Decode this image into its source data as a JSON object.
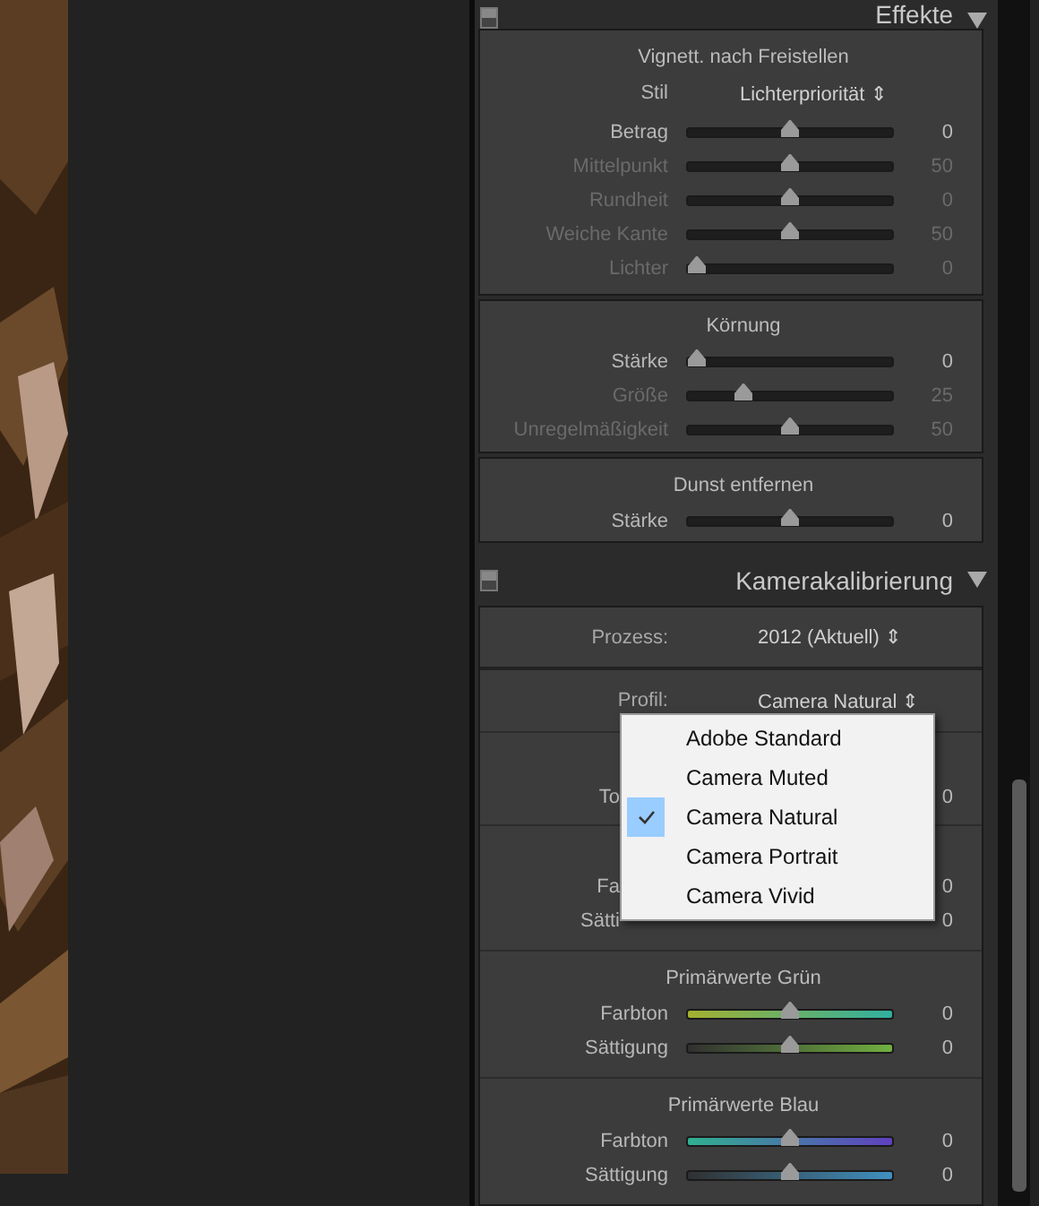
{
  "effects_header": {
    "title": "Effekte",
    "expanded": true
  },
  "effect_sections": [
    {
      "title": "Vignett. nach Freistellen",
      "select": {
        "label": "Stil",
        "value": "Lichterpriorität ⇕"
      },
      "sliders": [
        {
          "label": "Betrag",
          "value": "0",
          "level": 0.5,
          "disabled": false
        },
        {
          "label": "Mittelpunkt",
          "value": "50",
          "level": 0.5,
          "disabled": true
        },
        {
          "label": "Rundheit",
          "value": "0",
          "level": 0.5,
          "disabled": true
        },
        {
          "label": "Weiche Kante",
          "value": "50",
          "level": 0.5,
          "disabled": true
        },
        {
          "label": "Lichter",
          "value": "0",
          "level": 0,
          "disabled": true
        }
      ]
    },
    {
      "title": "Körnung",
      "sliders": [
        {
          "label": "Stärke",
          "value": "0",
          "level": 0,
          "disabled": false
        },
        {
          "label": "Größe",
          "value": "25",
          "level": 0.25,
          "disabled": true
        },
        {
          "label": "Unregelmäßigkeit",
          "value": "50",
          "level": 0.5,
          "disabled": true
        }
      ]
    },
    {
      "title": "Dunst entfernen",
      "sliders": [
        {
          "label": "Stärke",
          "value": "0",
          "level": 0.5,
          "disabled": false
        }
      ]
    }
  ],
  "calibration_header": {
    "title": "Kamerakalibrierung",
    "expanded": true
  },
  "calibration_selects": [
    {
      "label": "Prozess:",
      "value": "2012 (Aktuell) ⇕"
    },
    {
      "label": "Profil:",
      "value": "Camera Natural ⇕"
    }
  ],
  "covered_sections": [
    {
      "rows": [
        {
          "label": "To",
          "value": "0"
        }
      ]
    },
    {
      "rows": [
        {
          "label": "Fa",
          "value": "0"
        },
        {
          "label": "Sätti",
          "value": "0"
        }
      ]
    }
  ],
  "primary_sections": [
    {
      "title": "Primärwerte Grün",
      "sliders": [
        {
          "label": "Farbton",
          "value": "0",
          "level": 0.5,
          "kind": "hue"
        },
        {
          "label": "Sättigung",
          "value": "0",
          "level": 0.5,
          "kind": "saturation"
        }
      ]
    },
    {
      "title": "Primärwerte Blau",
      "sliders": [
        {
          "label": "Farbton",
          "value": "0",
          "level": 0.5,
          "kind": "hue"
        },
        {
          "label": "Sättigung",
          "value": "0",
          "level": 0.5,
          "kind": "saturation"
        }
      ]
    }
  ],
  "profile_menu": [
    {
      "label": "Adobe Standard",
      "selected": false
    },
    {
      "label": "Camera Muted",
      "selected": false
    },
    {
      "label": "Camera Natural",
      "selected": true
    },
    {
      "label": "Camera Portrait",
      "selected": false
    },
    {
      "label": "Camera Vivid",
      "selected": false
    }
  ]
}
